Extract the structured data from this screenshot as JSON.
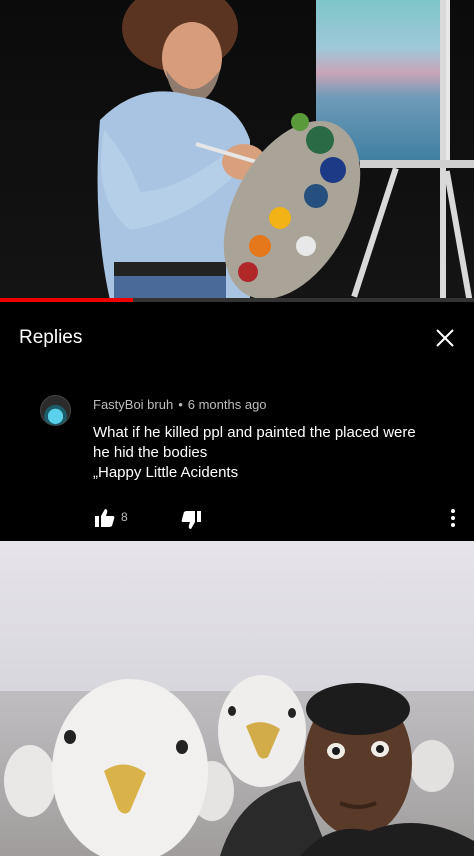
{
  "video": {
    "progress": 0.28,
    "accent_color": "#ee0000"
  },
  "replies": {
    "title": "Replies",
    "close_icon": "close-icon"
  },
  "comment": {
    "author": "FastyBoi bruh",
    "separator": "•",
    "time": "6 months ago",
    "text_lines": [
      "What if he killed ppl and painted the placed were",
      "he hid the bodies",
      "„Happy Little Acidents"
    ],
    "likes": "8",
    "like_icon": "thumbs-up-icon",
    "dislike_icon": "thumbs-down-icon",
    "more_icon": "more-vertical-icon"
  }
}
